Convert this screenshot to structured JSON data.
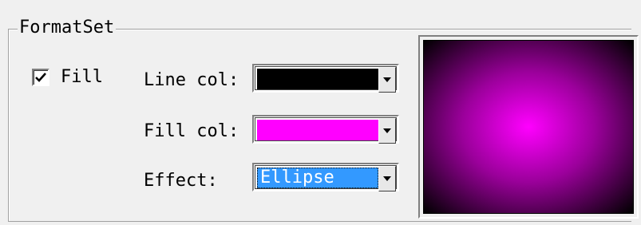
{
  "groupbox": {
    "title": "FormatSet"
  },
  "fill_checkbox": {
    "label": "Fill",
    "checked": true
  },
  "line_color": {
    "label": "Line col:",
    "value": "#000000"
  },
  "fill_color": {
    "label": "Fill col:",
    "value": "#ff00ff"
  },
  "effect": {
    "label": "Effect:",
    "selected": "Ellipse"
  },
  "preview": {
    "center_color": "#ff00ff",
    "edge_color": "#000000",
    "effect": "Ellipse"
  },
  "icons": {
    "checkmark": "checkmark-icon",
    "dropdown": "chevron-down-icon"
  }
}
